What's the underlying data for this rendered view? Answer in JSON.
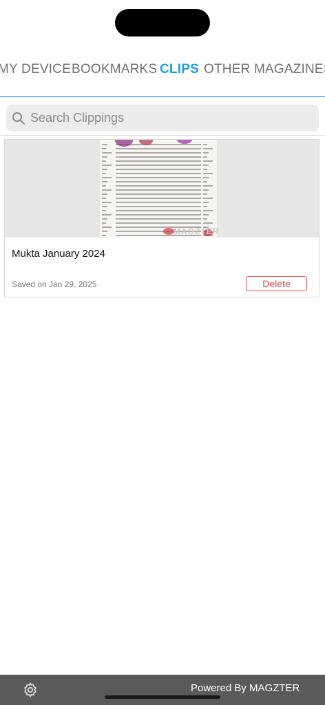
{
  "tabs": [
    {
      "label": "MY DEVICE",
      "active": false
    },
    {
      "label": "BOOKMARKS",
      "active": false
    },
    {
      "label": "CLIPS",
      "active": true
    },
    {
      "label": "OTHER MAGAZINES",
      "active": false
    }
  ],
  "search": {
    "placeholder": "Search Clippings"
  },
  "clippings": [
    {
      "title": "Mukta January 2024",
      "saved": "Saved on Jan 29, 2025",
      "delete_label": "Delete",
      "watermark": "MAGZTER"
    }
  ],
  "footer": {
    "powered_by": "Powered By MAGZTER"
  },
  "colors": {
    "accent": "#1ba1e2",
    "delete": "#e04444",
    "footer": "#5a5a5a"
  }
}
